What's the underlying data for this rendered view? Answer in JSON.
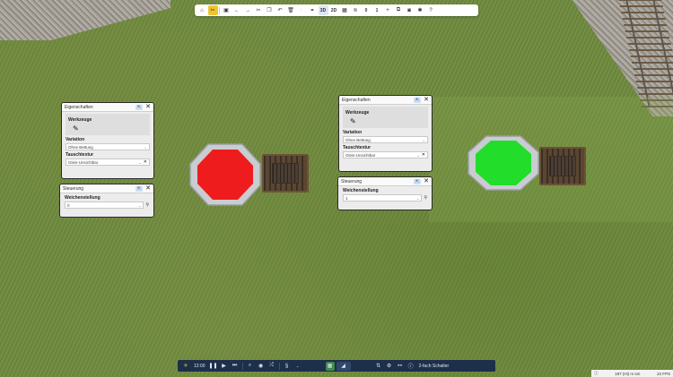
{
  "toolbar": {
    "items": [
      {
        "icon": "home-icon",
        "glyph": "⌂"
      },
      {
        "icon": "tools-icon",
        "glyph": "✂",
        "active": true
      },
      {
        "icon": "save-icon",
        "glyph": "▣"
      },
      {
        "icon": "undo-icon",
        "glyph": "←"
      },
      {
        "icon": "redo-icon",
        "glyph": "→"
      },
      {
        "icon": "cut-icon",
        "glyph": "✂"
      },
      {
        "icon": "copy-icon",
        "glyph": "❐"
      },
      {
        "icon": "paste-icon",
        "glyph": "↶"
      },
      {
        "icon": "delete-icon",
        "glyph": "🗑"
      },
      {
        "icon": "object-icon",
        "glyph": "◌"
      },
      {
        "icon": "link-icon",
        "glyph": "⚭"
      }
    ],
    "view_3d": "3D",
    "view_2d": "2D",
    "layer_value": "0",
    "layer_count": "1"
  },
  "panel1": {
    "title": "Eigenschaften",
    "werkzeuge_label": "Werkzeuge",
    "variation_label": "Variation",
    "variation_value": "Ohne Bettung",
    "tauschtextur_label": "Tauschtextur",
    "tauschtextur_value": "Gleis-Unsichtbar"
  },
  "steuerung1": {
    "title": "Steuerung",
    "weichenstellung_label": "Weichenstellung",
    "weichenstellung_value": "0"
  },
  "panel2": {
    "title": "Eigenschaften",
    "werkzeuge_label": "Werkzeuge",
    "variation_label": "Variation",
    "variation_value": "Ohne Bettung",
    "tauschtextur_label": "Tauschtextur",
    "tauschtextur_value": "Gleis-Unsichtbar"
  },
  "steuerung2": {
    "title": "Steuerung",
    "weichenstellung_label": "Weichenstellung",
    "weichenstellung_value": "1"
  },
  "signals": {
    "left_color": "#ee1c1c",
    "right_color": "#22dd2a"
  },
  "bottombar": {
    "time": "12:00",
    "object_name": "2-fach Schalter"
  },
  "status": {
    "left": "187 (Hi) m sm",
    "fps": "22 FPS"
  }
}
